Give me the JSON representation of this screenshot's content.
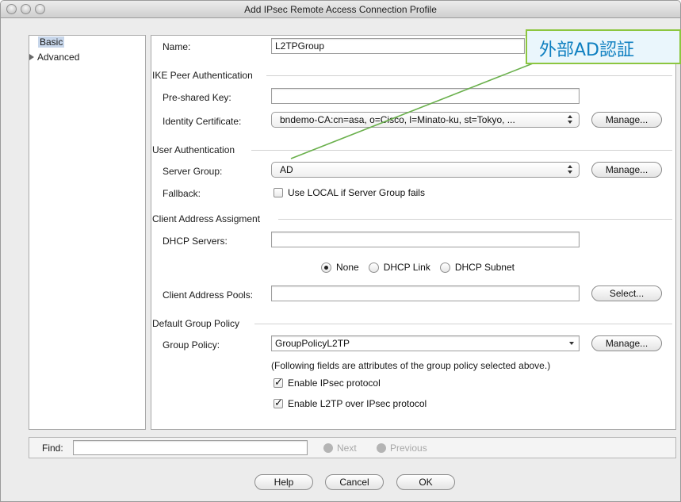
{
  "window": {
    "title": "Add IPsec Remote Access Connection Profile"
  },
  "nav": {
    "basic": "Basic",
    "advanced": "Advanced"
  },
  "form": {
    "name_label": "Name:",
    "name_value": "L2TPGroup",
    "ike_section": "IKE Peer Authentication",
    "psk_label": "Pre-shared Key:",
    "psk_value": "",
    "cert_label": "Identity Certificate:",
    "cert_value": "bndemo-CA:cn=asa, o=Cisco, l=Minato-ku, st=Tokyo, ...",
    "manage_label": "Manage...",
    "user_section": "User Authentication",
    "server_group_label": "Server Group:",
    "server_group_value": "AD",
    "fallback_label": "Fallback:",
    "fallback_text": "Use LOCAL if Server Group fails",
    "fallback_checked": false,
    "client_section": "Client Address Assigment",
    "dhcp_label": "DHCP Servers:",
    "dhcp_value": "",
    "radio_none": "None",
    "radio_dhcp_link": "DHCP Link",
    "radio_dhcp_subnet": "DHCP Subnet",
    "radio_selected": "None",
    "pools_label": "Client Address Pools:",
    "pools_value": "",
    "select_label": "Select...",
    "policy_section": "Default Group Policy",
    "policy_label": "Group Policy:",
    "policy_value": "GroupPolicyL2TP",
    "policy_note": "(Following fields are attributes of the group policy selected above.)",
    "ipsec_label": "Enable IPsec protocol",
    "ipsec_checked": true,
    "l2tp_label": "Enable L2TP over IPsec protocol",
    "l2tp_checked": true
  },
  "find": {
    "label": "Find:",
    "value": "",
    "next": "Next",
    "previous": "Previous"
  },
  "buttons": {
    "help": "Help",
    "cancel": "Cancel",
    "ok": "OK"
  },
  "callout": {
    "text": "外部AD認証",
    "border_color": "#8cc63f",
    "text_color": "#0e7fc0",
    "line_color": "#6ab04c"
  },
  "icons": {
    "window_controls": [
      "close-icon",
      "minimize-icon",
      "zoom-icon"
    ],
    "tree_toggle": "triangle-right-icon"
  }
}
